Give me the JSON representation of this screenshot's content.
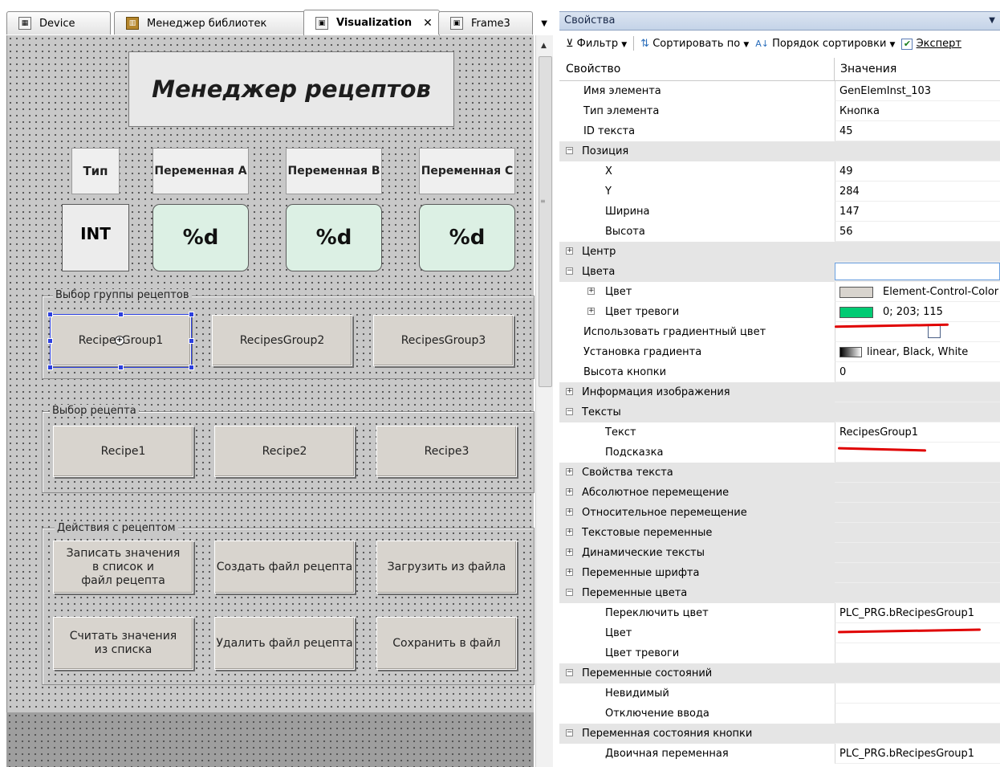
{
  "tabs": [
    {
      "label": "Device",
      "icon": "device-icon",
      "active": false
    },
    {
      "label": "Менеджер библиотек",
      "icon": "library-icon",
      "active": false
    },
    {
      "label": "Visualization",
      "icon": "visualization-icon",
      "active": true
    },
    {
      "label": "Frame3",
      "icon": "frame-icon",
      "active": false
    }
  ],
  "visualization": {
    "title": "Менеджер рецептов",
    "column_headers": [
      "Тип",
      "Переменная A",
      "Переменная B",
      "Переменная C"
    ],
    "row_values": [
      "INT",
      "%d",
      "%d",
      "%d"
    ],
    "group_recipe_groups": {
      "label": "Выбор группы рецептов",
      "buttons": [
        "RecipesGroup1",
        "RecipesGroup2",
        "RecipesGroup3"
      ]
    },
    "group_recipes": {
      "label": "Выбор рецепта",
      "buttons": [
        "Recipe1",
        "Recipe2",
        "Recipe3"
      ]
    },
    "group_actions": {
      "label": "Действия с рецептом",
      "buttons": [
        "Записать значения\nв список и\nфайл рецепта",
        "Создать файл рецепта",
        "Загрузить из файла",
        "Считать значения\nиз списка",
        "Удалить файл рецепта",
        "Сохранить в файл"
      ]
    }
  },
  "properties": {
    "panel_title": "Свойства",
    "toolbar": {
      "filter": "Фильтр",
      "sort_by": "Сортировать по",
      "sort_order": "Порядок сортировки",
      "expert": "Эксперт",
      "expert_checked": true
    },
    "columns": {
      "property": "Свойство",
      "value": "Значения"
    },
    "rows": [
      {
        "name": "Имя элемента",
        "value": "GenElemInst_103",
        "level": 1
      },
      {
        "name": "Тип элемента",
        "value": "Кнопка",
        "level": 1
      },
      {
        "name": "ID текста",
        "value": "45",
        "level": 1
      },
      {
        "name": "Позиция",
        "value": "",
        "level": 0,
        "category": true,
        "expander": "-"
      },
      {
        "name": "X",
        "value": "49",
        "level": 2
      },
      {
        "name": "Y",
        "value": "284",
        "level": 2
      },
      {
        "name": "Ширина",
        "value": "147",
        "level": 2
      },
      {
        "name": "Высота",
        "value": "56",
        "level": 2
      },
      {
        "name": "Центр",
        "value": "",
        "level": 0,
        "category": true,
        "expander": "+"
      },
      {
        "name": "Цвета",
        "value": "",
        "level": 0,
        "category": true,
        "expander": "-",
        "edit": true
      },
      {
        "name": "Цвет",
        "value": "Element-Control-Color",
        "level": 1,
        "expander": "+",
        "swatch": "#d8d4ce"
      },
      {
        "name": "Цвет тревоги",
        "value": "0; 203; 115",
        "level": 1,
        "expander": "+",
        "swatch": "#00cb73"
      },
      {
        "name": "Использовать градиентный цвет",
        "value": "",
        "level": 1,
        "checkbox": true
      },
      {
        "name": "Установка градиента",
        "value": "linear, Black, White",
        "level": 1,
        "gradient": true
      },
      {
        "name": "Высота кнопки",
        "value": "0",
        "level": 1
      },
      {
        "name": "Информация изображения",
        "value": "",
        "level": 0,
        "category": true,
        "expander": "+"
      },
      {
        "name": "Тексты",
        "value": "",
        "level": 0,
        "category": true,
        "expander": "-"
      },
      {
        "name": "Текст",
        "value": "RecipesGroup1",
        "level": 2
      },
      {
        "name": "Подсказка",
        "value": "",
        "level": 2
      },
      {
        "name": "Свойства текста",
        "value": "",
        "level": 0,
        "category": true,
        "expander": "+"
      },
      {
        "name": "Абсолютное перемещение",
        "value": "",
        "level": 0,
        "category": true,
        "expander": "+"
      },
      {
        "name": "Относительное перемещение",
        "value": "",
        "level": 0,
        "category": true,
        "expander": "+"
      },
      {
        "name": "Текстовые переменные",
        "value": "",
        "level": 0,
        "category": true,
        "expander": "+"
      },
      {
        "name": "Динамические тексты",
        "value": "",
        "level": 0,
        "category": true,
        "expander": "+"
      },
      {
        "name": "Переменные шрифта",
        "value": "",
        "level": 0,
        "category": true,
        "expander": "+"
      },
      {
        "name": "Переменные цвета",
        "value": "",
        "level": 0,
        "category": true,
        "expander": "-"
      },
      {
        "name": "Переключить цвет",
        "value": "PLC_PRG.bRecipesGroup1",
        "level": 2
      },
      {
        "name": "Цвет",
        "value": "",
        "level": 2
      },
      {
        "name": "Цвет тревоги",
        "value": "",
        "level": 2
      },
      {
        "name": "Переменные состояний",
        "value": "",
        "level": 0,
        "category": true,
        "expander": "-"
      },
      {
        "name": "Невидимый",
        "value": "",
        "level": 2
      },
      {
        "name": "Отключение ввода",
        "value": "",
        "level": 2
      },
      {
        "name": "Переменная состояния кнопки",
        "value": "",
        "level": 0,
        "category": true,
        "expander": "-"
      },
      {
        "name": "Двоичная переменная",
        "value": "PLC_PRG.bRecipesGroup1",
        "level": 2
      }
    ]
  },
  "colors": {
    "alarm_green": "#00cb73",
    "annotation_red": "#e00000",
    "selection_blue": "#2c3fde"
  }
}
